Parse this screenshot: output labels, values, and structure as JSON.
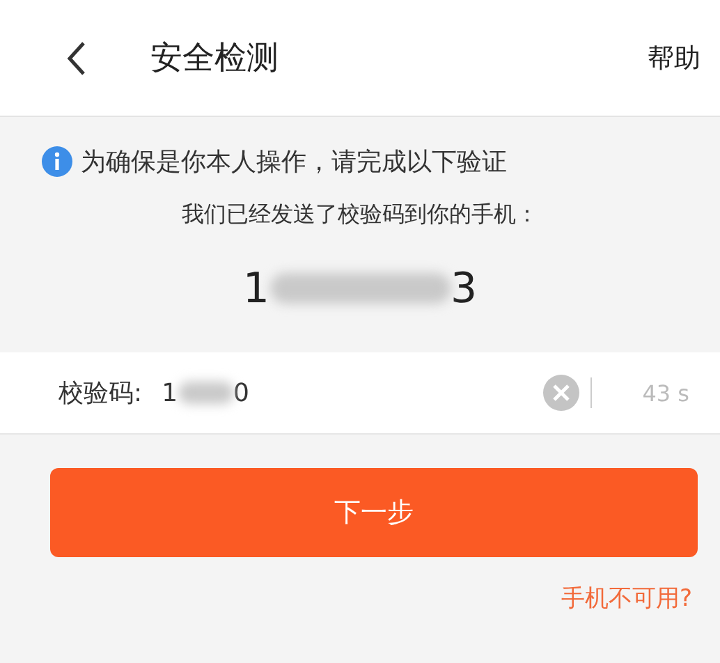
{
  "header": {
    "title": "安全检测",
    "help": "帮助"
  },
  "notice": {
    "text": "为确保是你本人操作，请完成以下验证"
  },
  "sent_message": "我们已经发送了校验码到你的手机：",
  "phone": {
    "start": "1",
    "end": "3"
  },
  "code_field": {
    "label": "校验码:",
    "value_start": "1",
    "value_end": "0",
    "countdown": "43 s"
  },
  "next_button": "下一步",
  "phone_unavailable_link": "手机不可用?"
}
